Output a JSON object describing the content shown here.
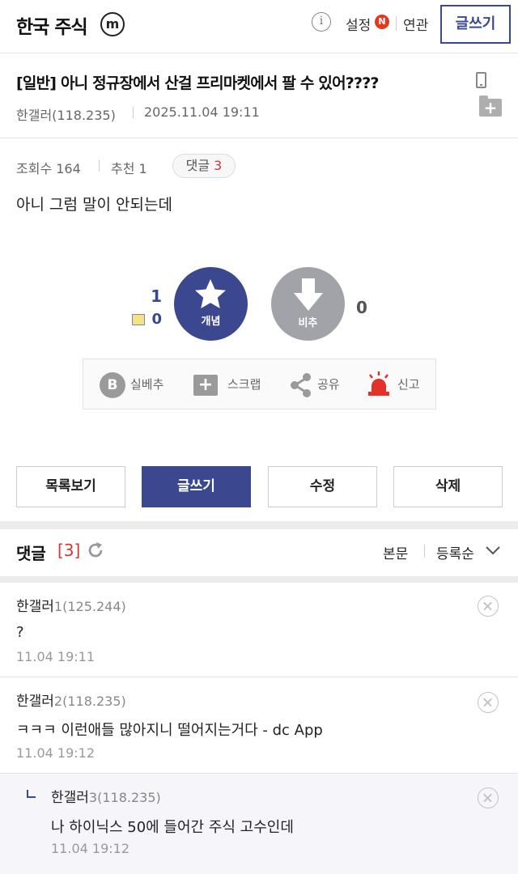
{
  "header": {
    "title": "한국 주식",
    "mobile_badge": "m",
    "info_label": "i",
    "settings_label": "설정",
    "new_badge": "N",
    "related_label": "연관",
    "write_label": "글쓰기"
  },
  "post": {
    "title": "[일반] 아니 정규장에서 산걸 프리마켓에서 팔 수 있어????",
    "author": "한갤러(118.235)",
    "date": "2025.11.04 19:11",
    "views": "조회수 164",
    "recommend": "추천 1",
    "comment_pill_label": "댓글",
    "comment_pill_count": "3",
    "body": "아니 그럼 말이 안되는데"
  },
  "vote": {
    "up_count": "1",
    "fix_count": "0",
    "up_label": "개념",
    "down_label": "비추",
    "down_count": "0"
  },
  "actions": {
    "silbechu": "실베추",
    "scrap": "스크랩",
    "share": "공유",
    "report": "신고"
  },
  "buttons": {
    "list": "목록보기",
    "write": "글쓰기",
    "edit": "수정",
    "delete": "삭제"
  },
  "comments_header": {
    "title": "댓글",
    "count": "[3]",
    "body_label": "본문",
    "order_label": "등록순"
  },
  "comments": [
    {
      "nick": "한갤러",
      "num": "1",
      "ip": "(125.244)",
      "text": "?",
      "time": "11.04 19:11"
    },
    {
      "nick": "한갤러",
      "num": "2",
      "ip": "(118.235)",
      "text": "ㅋㅋㅋ 이런애들 많아지니 떨어지는거다 - dc App",
      "time": "11.04 19:12"
    },
    {
      "nick": "한갤러",
      "num": "3",
      "ip": "(118.235)",
      "text": "나 하이닉스 50에 들어간 주식 고수인데",
      "time": "11.04 19:12",
      "reply": true
    }
  ],
  "colors": {
    "brand": "#3b4890",
    "accent_red": "#d33",
    "downvote_gray": "#a2a3a9"
  }
}
